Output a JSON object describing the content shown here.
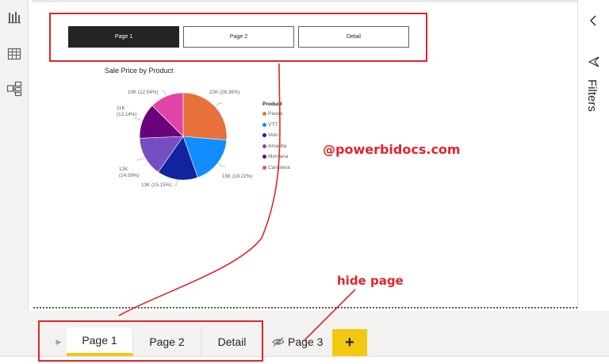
{
  "nav_buttons": [
    {
      "label": "Page 1",
      "active": true
    },
    {
      "label": "Page 2",
      "active": false
    },
    {
      "label": "Detail",
      "active": false
    }
  ],
  "chart": {
    "title": "Sale Price by Product"
  },
  "chart_data": {
    "type": "pie",
    "title": "Sale Price by Product",
    "legend_title": "Product",
    "legend_position": "right",
    "slices": [
      {
        "name": "Paseo",
        "label": "22K (26.36%)",
        "value": 22,
        "percent": 26.36,
        "color": "#e8703a"
      },
      {
        "name": "VTT",
        "label": "15K (18.22%)",
        "value": 15,
        "percent": 18.22,
        "color": "#118dff"
      },
      {
        "name": "Velo",
        "label": "13K (15.15%)",
        "value": 13,
        "percent": 15.15,
        "color": "#12239e"
      },
      {
        "name": "Amarilla",
        "label": "12K (14.59%)",
        "value": 12,
        "percent": 14.59,
        "color": "#744ec2"
      },
      {
        "name": "Montana",
        "label": "11K (13.14%)",
        "value": 11,
        "percent": 13.14,
        "color": "#6b007b"
      },
      {
        "name": "Carretera",
        "label": "10K (12.54%)",
        "value": 10,
        "percent": 12.54,
        "color": "#e044a7"
      }
    ]
  },
  "annotations": {
    "watermark": "@powerbidocs.com",
    "hide_page": "hide page"
  },
  "filters_pane": {
    "label": "Filters",
    "collapse_icon": "chevron-left-icon",
    "filter_icon": "funnel-icon"
  },
  "tabs": [
    {
      "label": "Page 1",
      "active": true
    },
    {
      "label": "Page 2",
      "active": false
    },
    {
      "label": "Detail",
      "active": false
    }
  ],
  "hidden_tab": {
    "label": "Page 3",
    "icon": "eye-hidden-icon"
  },
  "add_page": {
    "label": "+"
  },
  "left_rail": {
    "icons": [
      "report-view-icon",
      "data-view-icon",
      "model-view-icon"
    ]
  },
  "colors": {
    "accent": "#f2c811",
    "annotation": "#e0252b"
  }
}
